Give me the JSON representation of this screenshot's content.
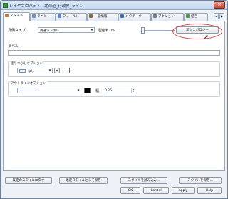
{
  "window": {
    "title": "レイヤプロパティ - 北海道_行政界_ライン"
  },
  "tabs": [
    {
      "label": "スタイル",
      "icon": "brush-icon",
      "color": "#c9742a"
    },
    {
      "label": "ラベル",
      "icon": "label-icon",
      "color": "#6f8fc4"
    },
    {
      "label": "フィールド",
      "icon": "table-icon",
      "color": "#4f8ad6"
    },
    {
      "label": "一般情報",
      "icon": "wrench-icon",
      "color": "#8a6d3b"
    },
    {
      "label": "メタデータ",
      "icon": "info-icon",
      "color": "#2f76c9"
    },
    {
      "label": "アクション",
      "icon": "gear-icon",
      "color": "#6a7a8c"
    },
    {
      "label": "結合",
      "icon": "join-icon",
      "color": "#4c9a4c"
    }
  ],
  "style": {
    "legend_type_label": "凡例タイプ",
    "legend_type_value": "共通シンボル",
    "transparency_label": "透過率 0%",
    "transparency_percent": 0,
    "new_symbology_button": "新シンボロジー",
    "label_label": "ラベル",
    "label_value": "",
    "fill_group_title": "塗りつぶしオプション",
    "fill_pattern_value": "なし",
    "fill_color": "#ffffff",
    "outline_group_title": "アウトラインオプション",
    "outline_color": "#000000",
    "width_label": "幅",
    "width_value": "0.26"
  },
  "bottom_buttons": {
    "restore_default": "既定のスタイルに戻す",
    "save_as_default": "既定スタイルとして保存",
    "load_style": "スタイルを読み込み...",
    "save_style": "スタイルを保存..."
  },
  "dialog_buttons": {
    "ok": "OK",
    "cancel": "Cancel",
    "apply": "Apply",
    "help": "Help"
  },
  "colors": {
    "highlight": "#dd3333",
    "title_bar": "#c4d7ee",
    "window_border": "#6f84a3"
  }
}
